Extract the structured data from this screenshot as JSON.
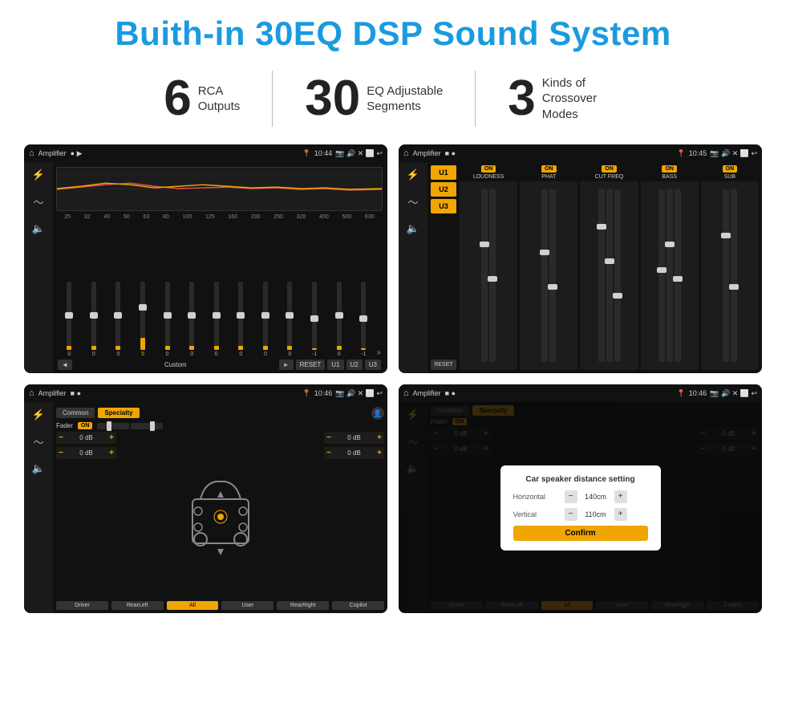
{
  "header": {
    "title": "Buith-in 30EQ DSP Sound System"
  },
  "stats": [
    {
      "number": "6",
      "label": "RCA\nOutputs"
    },
    {
      "number": "30",
      "label": "EQ Adjustable\nSegments"
    },
    {
      "number": "3",
      "label": "Kinds of\nCrossover Modes"
    }
  ],
  "screens": {
    "eq": {
      "title": "Amplifier",
      "time": "10:44",
      "freqs": [
        "25",
        "32",
        "40",
        "50",
        "63",
        "80",
        "100",
        "125",
        "160",
        "200",
        "250",
        "320",
        "400",
        "500",
        "630"
      ],
      "values": [
        "0",
        "0",
        "0",
        "5",
        "0",
        "0",
        "0",
        "0",
        "0",
        "0",
        "-1",
        "0",
        "-1"
      ],
      "buttons": [
        "◄",
        "Custom",
        "►",
        "RESET",
        "U1",
        "U2",
        "U3"
      ]
    },
    "crossover": {
      "title": "Amplifier",
      "time": "10:45",
      "presets": [
        "U1",
        "U2",
        "U3"
      ],
      "channels": [
        {
          "toggle": "ON",
          "name": "LOUDNESS"
        },
        {
          "toggle": "ON",
          "name": "PHAT"
        },
        {
          "toggle": "ON",
          "name": "CUT FREQ"
        },
        {
          "toggle": "ON",
          "name": "BASS"
        },
        {
          "toggle": "ON",
          "name": "SUB"
        }
      ]
    },
    "speaker": {
      "title": "Amplifier",
      "time": "10:46",
      "tabs": [
        "Common",
        "Specialty"
      ],
      "fader": "Fader",
      "faderToggle": "ON",
      "volumes": [
        "0 dB",
        "0 dB",
        "0 dB",
        "0 dB"
      ],
      "bottomButtons": [
        "Driver",
        "RearLeft",
        "All",
        "User",
        "RearRight",
        "Copilot"
      ]
    },
    "dialog": {
      "title": "Amplifier",
      "time": "10:46",
      "tabs": [
        "Common",
        "Specialty"
      ],
      "dialogTitle": "Car speaker distance setting",
      "horizontal": {
        "label": "Horizontal",
        "value": "140cm"
      },
      "vertical": {
        "label": "Vertical",
        "value": "110cm"
      },
      "confirm": "Confirm",
      "bottomButtons": [
        "Driver",
        "RearLeft",
        "All",
        "User",
        "RearRight",
        "Copilot"
      ]
    }
  }
}
